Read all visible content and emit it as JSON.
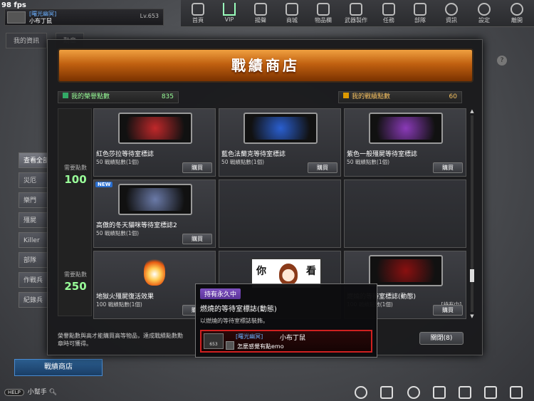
{
  "fps": "98 fps",
  "profile": {
    "guild": "[曙光幽冥]",
    "name": "小布丁鼠",
    "level": "Lv.653"
  },
  "nav": [
    {
      "label": "首頁",
      "icon": "home-icon"
    },
    {
      "label": "VIP",
      "icon": "vip-crown-icon"
    },
    {
      "label": "揚聲",
      "icon": "speaker-icon"
    },
    {
      "label": "商城",
      "icon": "shop-icon"
    },
    {
      "label": "物品欄",
      "icon": "inventory-icon"
    },
    {
      "label": "武器製作",
      "icon": "weapon-craft-icon"
    },
    {
      "label": "任務",
      "icon": "mission-icon"
    },
    {
      "label": "部隊",
      "icon": "clan-icon"
    },
    {
      "label": "資訊",
      "icon": "info-icon"
    },
    {
      "label": "設定",
      "icon": "gear-icon"
    },
    {
      "label": "離開",
      "icon": "power-icon"
    }
  ],
  "background": {
    "tabs": [
      "我的資訊",
      "勳章"
    ],
    "side_items": [
      "查看全部",
      "災厄",
      "樂門",
      "殭屍",
      "Killer",
      "部隊",
      "作戰兵",
      "紀錄兵"
    ],
    "shop_button": "戰績商店",
    "helper_pill": "HELP",
    "helper_label": "小幫手"
  },
  "modal": {
    "title": "戰績商店",
    "help": "?",
    "honor_label": "我的榮譽點數",
    "honor_value": "835",
    "merit_label": "我的戰績點數",
    "merit_value": "60",
    "tiers": [
      {
        "req": "需要點數",
        "value": "100"
      },
      {
        "req": "需要點數",
        "value": "250"
      }
    ],
    "cards": [
      {
        "name": "紅色莎拉等待室標誌",
        "cost": "50 戰績點數(1個)",
        "buy": "購買",
        "color": "#c0282a",
        "new": "",
        "tag": ""
      },
      {
        "name": "藍色法蘭克等待室標誌",
        "cost": "50 戰績點數(1個)",
        "buy": "購買",
        "color": "#2a5fd0",
        "new": "",
        "tag": ""
      },
      {
        "name": "紫色一般殭屍等待室標誌",
        "cost": "50 戰績點數(1個)",
        "buy": "購買",
        "color": "#8a3ab8",
        "new": "",
        "tag": ""
      },
      {
        "name": "高傲的冬天貓咪等待室標誌2",
        "cost": "50 戰績點數(1個)",
        "buy": "購買",
        "color": "#6a7aa8",
        "new": "NEW",
        "tag": ""
      },
      {
        "name": "地獄火殭屍復活效果",
        "cost": "100 戰績點數(1個)",
        "buy": "購買",
        "color": "",
        "new": "",
        "tag": ""
      },
      {
        "name": "燃燒的等待室標誌(動態)",
        "cost": "100 戰績點數(1個)",
        "buy": "購買",
        "color": "#8a1010",
        "new": "",
        "tag": "[持有中]"
      }
    ],
    "footer": "榮譽點數與高才能購買高等物品，達成戰績點數勳章時可獲得。",
    "close": "關閉(8)"
  },
  "tooltip": {
    "permanent": "持有永久中",
    "name": "燃燒的等待室標誌(動態)",
    "desc": "以燃燒的等待室標誌裝飾。",
    "preview_level": "653",
    "preview_guild": "[曙光幽冥]",
    "preview_name": "小布丁鼠",
    "preview_msg": "怎麼感覺有點emo"
  },
  "sticker": {
    "left": "你",
    "right": "看"
  }
}
